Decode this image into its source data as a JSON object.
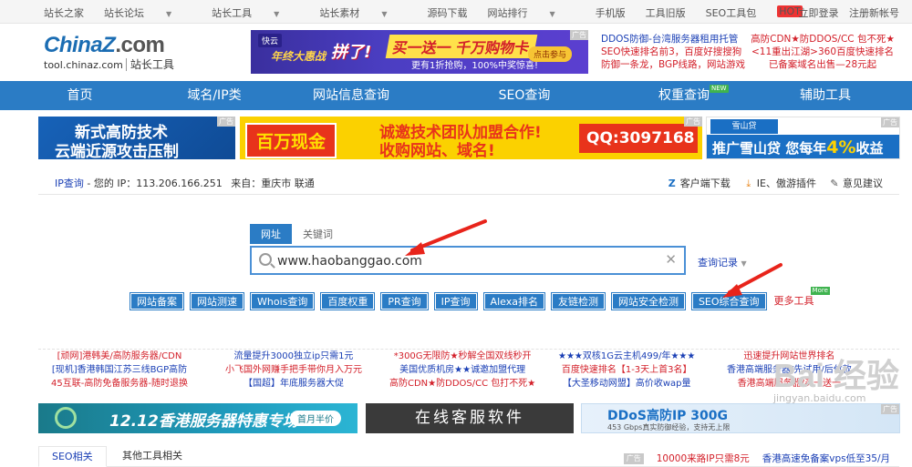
{
  "topbar": {
    "links": [
      "站长之家",
      "站长论坛",
      "站长工具",
      "站长素材",
      "源码下载",
      "网站排行",
      "手机版",
      "工具旧版",
      "SEO工具包"
    ],
    "hot_badge": "HOT",
    "login": "立即登录",
    "register": "注册新帐号"
  },
  "header": {
    "logo_brand": "ChinaZ",
    "logo_domain": ".com",
    "logo_url": "tool.chinaz.com",
    "logo_name": "站长工具",
    "banner": {
      "tag": "快云",
      "t1": "年终大惠战",
      "t2": "拼了!",
      "t3": "买一送一 千万购物卡",
      "t4": "更有1折抢购，100%中奖惊喜!",
      "t5": "点击参与"
    },
    "ad_a1": [
      "DDOS防御-台湾服务器租用托管",
      "SEO快速排名前3，百度好搜搜狗",
      "防御一条龙，BGP线路，网站游戏"
    ],
    "ad_a2": [
      "高防CDN★防DDOS/CC 包不死★",
      "<11重出江湖>360百度快速排名",
      "已备案域名出售—28元起"
    ],
    "ad_label": "广告"
  },
  "nav": {
    "items": [
      "首页",
      "域名/IP类",
      "网站信息查询",
      "SEO查询",
      "权重查询",
      "辅助工具"
    ],
    "new_badge": "NEW"
  },
  "ads_row": {
    "b1_l1": "新式高防技术",
    "b1_l2": "云端近源攻击压制",
    "b2_red": "百万现金",
    "b2_l1": "诚邀技术团队加盟合作!",
    "b2_l2": "收购网站、域名!",
    "b2_qq": "QQ:3097168",
    "b3_logo": "雪山贷",
    "b3_text": "推广雪山贷 您每年",
    "b3_pct": "4%",
    "b3_tail": "收益"
  },
  "infobar": {
    "ip_label": "IP查询",
    "your_ip": "- 您的 IP：113.206.166.251",
    "from": "来自：重庆市 联通",
    "client": "客户端下载",
    "plugin": "IE、傲游插件",
    "feedback": "意见建议"
  },
  "search": {
    "tabs": [
      "网址",
      "关键词"
    ],
    "value": "www.haobanggao.com",
    "history": "查询记录",
    "tools": [
      "网站备案",
      "网站测速",
      "Whois查询",
      "百度权重",
      "PR查询",
      "IP查询",
      "Alexa排名",
      "友链检测",
      "网站安全检测",
      "SEO综合查询"
    ],
    "more": "更多工具",
    "more_badge": "More"
  },
  "textads": {
    "col1": [
      "[顽网]港韩美/高防服务器/CDN",
      "[现机]香港韩国江苏三线BGP高防",
      "45互联-高防免备服务器-随时退换"
    ],
    "col2": [
      "流量提升3000独立ip只需1元",
      "小飞国外网赚手把手带你月入万元",
      "【国超】年底服务器大促"
    ],
    "col3": [
      "*300G无限防★秒解全国双线秒开",
      "美国优质机房★★诚邀加盟代理",
      "高防CDN★防DDOS/CC 包打不死★"
    ],
    "col4": [
      "★★★双核1G云主机499/年★★★",
      "百度快速排名【1-3天上首3名】",
      "【大圣移动网盟】高价收wap量"
    ],
    "col5": [
      "迅速提升网站世界排名",
      "香港高端服务器/先试用/后付款",
      "香港高端服务器/买一送一"
    ]
  },
  "bottom_ads": {
    "d1_big": "12.12香港服务器特惠专场",
    "d1_pill": "首月半价",
    "d2": "在线客服软件",
    "d3_t1": "DDoS高防IP 300G",
    "d3_t2": "453 Gbps真实防御经验，支持无上限"
  },
  "watermark": {
    "brand": "Bai 经验",
    "url": "jingyan.baidu.com"
  },
  "btabs": {
    "tabs": [
      "SEO相关",
      "其他工具相关"
    ],
    "ad_tag": "广告",
    "r1": "10000来路IP只需8元",
    "r2": "香港高速免备案vps低至35/月"
  }
}
